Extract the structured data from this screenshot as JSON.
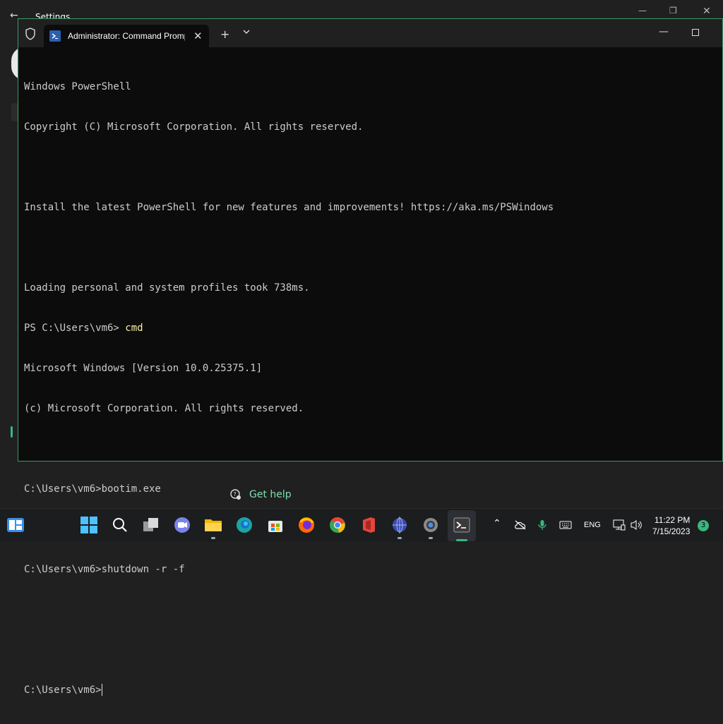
{
  "background_window": {
    "title": "Settings",
    "get_help": "Get help"
  },
  "terminal": {
    "tab_title": "Administrator: Command Prompt",
    "lines": [
      {
        "text": "Windows PowerShell"
      },
      {
        "text": "Copyright (C) Microsoft Corporation. All rights reserved."
      },
      {
        "text": ""
      },
      {
        "text": "Install the latest PowerShell for new features and improvements! https://aka.ms/PSWindows"
      },
      {
        "text": ""
      },
      {
        "text": "Loading personal and system profiles took 738ms."
      },
      {
        "text": "PS C:\\Users\\vm6> ",
        "cmd": "cmd"
      },
      {
        "text": "Microsoft Windows [Version 10.0.25375.1]"
      },
      {
        "text": "(c) Microsoft Corporation. All rights reserved."
      },
      {
        "text": ""
      },
      {
        "text": "C:\\Users\\vm6>bootim.exe"
      },
      {
        "text": ""
      },
      {
        "text": "C:\\Users\\vm6>shutdown -r -f"
      },
      {
        "text": ""
      },
      {
        "text": ""
      },
      {
        "text": "C:\\Users\\vm6>"
      }
    ]
  },
  "taskbar": {
    "language": "ENG",
    "time": "11:22 PM",
    "date": "7/15/2023",
    "notifications": "3"
  }
}
